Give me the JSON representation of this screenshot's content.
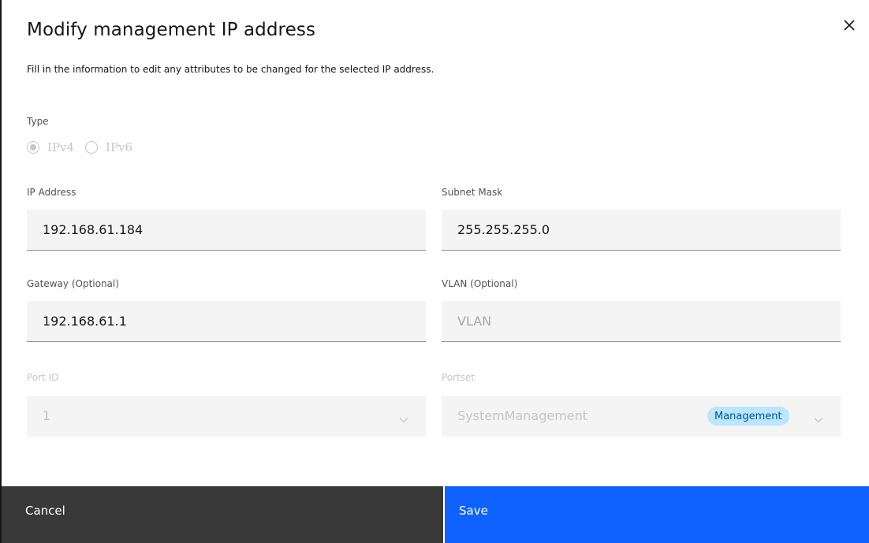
{
  "modal": {
    "title": "Modify management IP address",
    "description": "Fill in the information to edit any attributes to be changed for the selected IP address."
  },
  "type": {
    "label": "Type",
    "options": [
      {
        "label": "IPv4",
        "selected": true
      },
      {
        "label": "IPv6",
        "selected": false
      }
    ]
  },
  "ip_address": {
    "label": "IP Address",
    "value": "192.168.61.184"
  },
  "subnet_mask": {
    "label": "Subnet Mask",
    "value": "255.255.255.0"
  },
  "gateway": {
    "label": "Gateway (Optional)",
    "value": "192.168.61.1"
  },
  "vlan": {
    "label": "VLAN (Optional)",
    "placeholder": "VLAN"
  },
  "port_id": {
    "label": "Port ID",
    "value": "1"
  },
  "portset": {
    "label": "Portset",
    "value": "SystemManagement",
    "tag": "Management"
  },
  "footer": {
    "cancel_label": "Cancel",
    "save_label": "Save"
  },
  "colors": {
    "primary": "#0f62fe",
    "secondary_button": "#393939",
    "tag_background": "#bae6ff",
    "field_background": "#f4f4f4"
  },
  "icons": {
    "close": "close-icon",
    "chevron": "chevron-down-icon"
  }
}
